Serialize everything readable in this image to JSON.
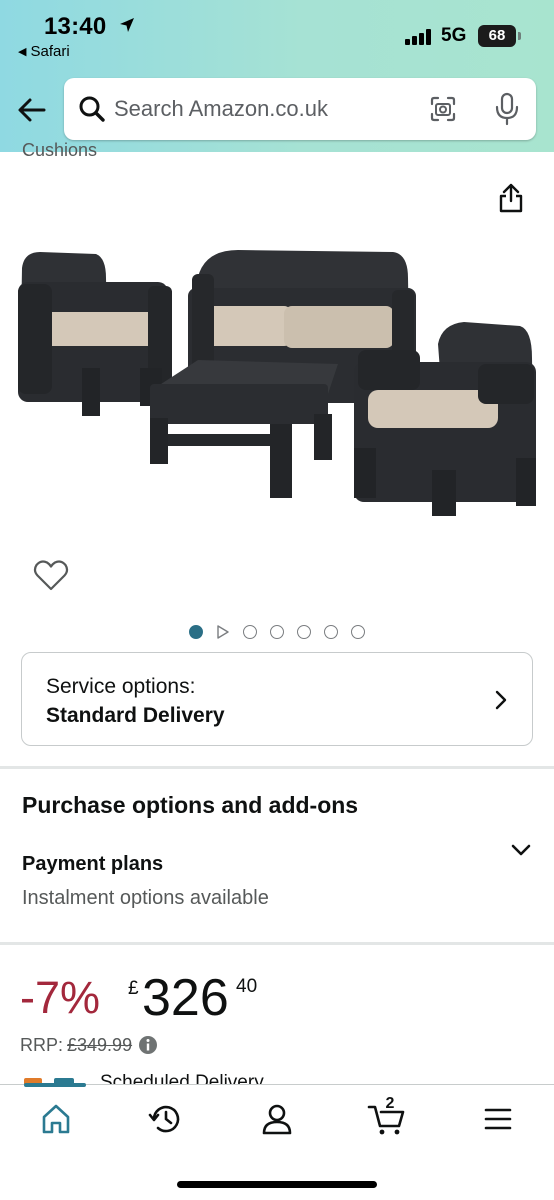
{
  "status_bar": {
    "time": "13:40",
    "back_app": "Safari",
    "network": "5G",
    "battery": "68"
  },
  "search": {
    "placeholder": "Search Amazon.co.uk"
  },
  "product": {
    "title_fragment": "Cushions",
    "image_alt": "Rattan garden furniture set: two armchairs, a two-seater sofa and a coffee table with beige cushions",
    "carousel": {
      "count": 7,
      "active_index": 0,
      "video_index": 1
    }
  },
  "service_options": {
    "label": "Service options:",
    "value": "Standard Delivery"
  },
  "purchase": {
    "heading": "Purchase options and add-ons",
    "payment_title": "Payment plans",
    "payment_sub": "Instalment options available"
  },
  "price": {
    "discount": "-7%",
    "currency": "£",
    "whole": "326",
    "fraction": "40",
    "rrp_label": "RRP:",
    "rrp_value": "£349.99"
  },
  "scheduled_delivery": "Scheduled Delivery",
  "bottom_nav": {
    "items": [
      "home",
      "history",
      "account",
      "cart",
      "menu"
    ],
    "cart_count": "2"
  },
  "colors": {
    "header_gradient_start": "#8fd9e2",
    "header_gradient_end": "#a8e4cf",
    "discount_red": "#a3283c",
    "accent_teal": "#2b7a91",
    "carousel_active": "#2b6f86"
  }
}
